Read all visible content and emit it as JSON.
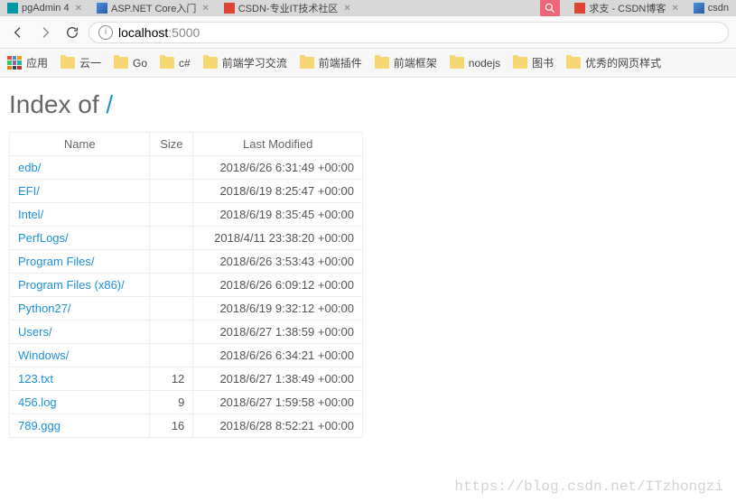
{
  "tabs": [
    {
      "label": "pgAdmin 4"
    },
    {
      "label": "ASP.NET Core入门"
    },
    {
      "label": "CSDN-专业IT技术社区"
    },
    {
      "label": "求支 - CSDN博客"
    },
    {
      "label": "csdn"
    }
  ],
  "address": {
    "host": "localhost",
    "port": ":5000"
  },
  "bookmarks": {
    "apps_label": "应用",
    "items": [
      "云一",
      "Go",
      "c#",
      "前端学习交流",
      "前端插件",
      "前端框架",
      "nodejs",
      "图书",
      "优秀的网页样式"
    ]
  },
  "page": {
    "heading_prefix": "Index of ",
    "heading_path": "/",
    "columns": {
      "name": "Name",
      "size": "Size",
      "modified": "Last Modified"
    },
    "rows": [
      {
        "name": "edb/",
        "size": "",
        "modified": "2018/6/26 6:31:49 +00:00"
      },
      {
        "name": "EFI/",
        "size": "",
        "modified": "2018/6/19 8:25:47 +00:00"
      },
      {
        "name": "Intel/",
        "size": "",
        "modified": "2018/6/19 8:35:45 +00:00"
      },
      {
        "name": "PerfLogs/",
        "size": "",
        "modified": "2018/4/11 23:38:20 +00:00"
      },
      {
        "name": "Program Files/",
        "size": "",
        "modified": "2018/6/26 3:53:43 +00:00"
      },
      {
        "name": "Program Files (x86)/",
        "size": "",
        "modified": "2018/6/26 6:09:12 +00:00"
      },
      {
        "name": "Python27/",
        "size": "",
        "modified": "2018/6/19 9:32:12 +00:00"
      },
      {
        "name": "Users/",
        "size": "",
        "modified": "2018/6/27 1:38:59 +00:00"
      },
      {
        "name": "Windows/",
        "size": "",
        "modified": "2018/6/26 6:34:21 +00:00"
      },
      {
        "name": "123.txt",
        "size": "12",
        "modified": "2018/6/27 1:38:49 +00:00"
      },
      {
        "name": "456.log",
        "size": "9",
        "modified": "2018/6/27 1:59:58 +00:00"
      },
      {
        "name": "789.ggg",
        "size": "16",
        "modified": "2018/6/28 8:52:21 +00:00"
      }
    ]
  },
  "watermark": "https://blog.csdn.net/ITzhongzi"
}
